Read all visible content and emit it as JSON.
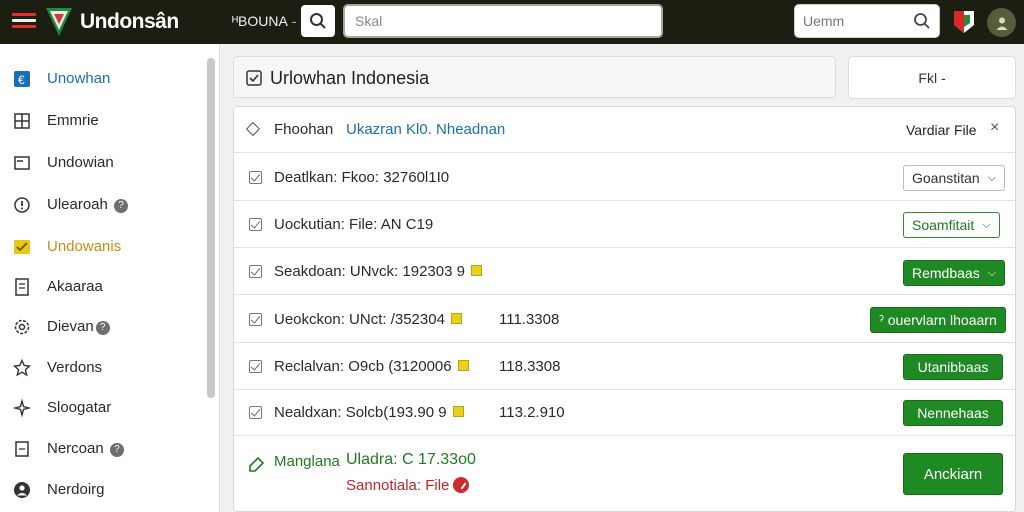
{
  "header": {
    "brand": "Undonsân",
    "nav_select": "ᴴBOUNA",
    "nav_caret": "-",
    "search_placeholder": "Skal",
    "search_right_placeholder": "Uemm"
  },
  "sidebar": {
    "items": [
      {
        "label": "Unowhan",
        "icon": "link-icon",
        "help": ""
      },
      {
        "label": "Emmrie",
        "icon": "layout-icon",
        "help": ""
      },
      {
        "label": "Undowian",
        "icon": "inbox-icon",
        "help": ""
      },
      {
        "label": "Ulearoah",
        "icon": "info-icon",
        "help": "?"
      },
      {
        "label": "Undowanis",
        "icon": "checklist-icon",
        "help": ""
      },
      {
        "label": "Akaaraa",
        "icon": "printer-icon",
        "help": ""
      },
      {
        "label": "Dievan",
        "icon": "settings-icon",
        "help": "?"
      },
      {
        "label": "Verdons",
        "icon": "star-icon",
        "help": ""
      },
      {
        "label": "Sloogatar",
        "icon": "sparkle-icon",
        "help": ""
      },
      {
        "label": "Nercoan",
        "icon": "document-icon",
        "help": "?"
      },
      {
        "label": "Nerdoirg",
        "icon": "user-icon",
        "help": ""
      }
    ]
  },
  "main": {
    "title": "Urlowhan Indonesia",
    "field_button": "Fkl -",
    "panel_header": {
      "label": "Fhoohan",
      "link": "Ukazran Kl0. Nheadnan",
      "variant": "Vardiar File",
      "close": "×"
    },
    "rows": [
      {
        "text": "Deatlkan: Fkoo: 32760l1I0",
        "badge": false,
        "num": "",
        "select": "Goanstitan",
        "style": "gray",
        "caret": "⌵"
      },
      {
        "text": "Uockutian: File:    AN C19",
        "badge": false,
        "num": "",
        "select": "Soamfitait",
        "style": "green-outline",
        "caret": "⌵"
      },
      {
        "text": "Seakdoan: UNvck: 192303 9",
        "badge": true,
        "num": "",
        "select": "Remdbaas",
        "style": "green",
        "caret": "⌵"
      },
      {
        "text": "Ueokckon: UNct: /352304",
        "badge": true,
        "num": "111.3308",
        "select": "ˀ ouervlarn lhoaarn",
        "style": "green",
        "caret": ""
      },
      {
        "text": "Reclalvan: O9cb (3120006",
        "badge": true,
        "num": "118.3308",
        "select": "Utanibbaas",
        "style": "green",
        "caret": ""
      },
      {
        "text": "Nealdxan: Solcb(193.90 9",
        "badge": true,
        "num": "113.2.910",
        "select": "Nennehaas",
        "style": "green",
        "caret": ""
      }
    ],
    "footer": {
      "line1_label": "Manglana",
      "line1_value": "Uladra: C  17.33o0",
      "line2": "Sannotiala: File",
      "action": "Anckiarn"
    }
  }
}
